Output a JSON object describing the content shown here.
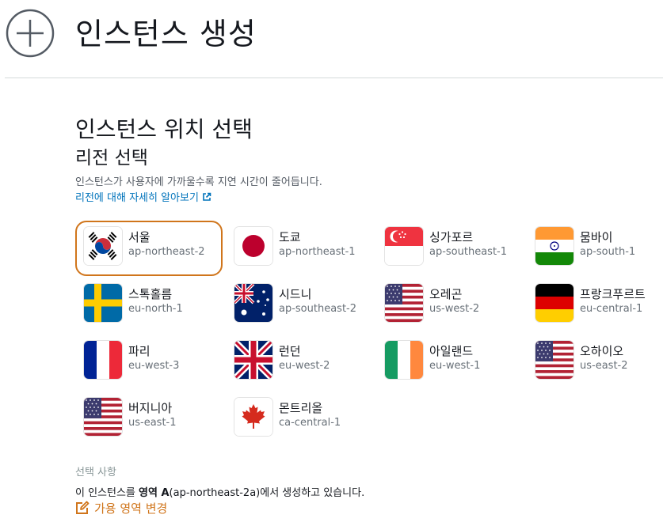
{
  "header": {
    "title": "인스턴스 생성",
    "icon": "plus-circle-icon"
  },
  "section": {
    "title": "인스턴스 위치 선택",
    "subtitle": "리전 선택",
    "description": "인스턴스가 사용자에 가까울수록 지연 시간이 줄어듭니다.",
    "learn_more": "리전에 대해 자세히 알아보기"
  },
  "regions": [
    {
      "name": "서울",
      "code": "ap-northeast-2",
      "flag": "korea-flag-icon",
      "selected": true
    },
    {
      "name": "도쿄",
      "code": "ap-northeast-1",
      "flag": "japan-flag-icon"
    },
    {
      "name": "싱가포르",
      "code": "ap-southeast-1",
      "flag": "singapore-flag-icon"
    },
    {
      "name": "뭄바이",
      "code": "ap-south-1",
      "flag": "india-flag-icon"
    },
    {
      "name": "스톡홀름",
      "code": "eu-north-1",
      "flag": "sweden-flag-icon"
    },
    {
      "name": "시드니",
      "code": "ap-southeast-2",
      "flag": "australia-flag-icon"
    },
    {
      "name": "오레곤",
      "code": "us-west-2",
      "flag": "usa-flag-icon"
    },
    {
      "name": "프랑크푸르트",
      "code": "eu-central-1",
      "flag": "germany-flag-icon"
    },
    {
      "name": "파리",
      "code": "eu-west-3",
      "flag": "france-flag-icon"
    },
    {
      "name": "런던",
      "code": "eu-west-2",
      "flag": "uk-flag-icon"
    },
    {
      "name": "아일랜드",
      "code": "eu-west-1",
      "flag": "ireland-flag-icon"
    },
    {
      "name": "오하이오",
      "code": "us-east-2",
      "flag": "usa-flag-icon"
    },
    {
      "name": "버지니아",
      "code": "us-east-1",
      "flag": "usa-flag-icon"
    },
    {
      "name": "몬트리올",
      "code": "ca-central-1",
      "flag": "canada-flag-icon"
    }
  ],
  "selection": {
    "label": "선택 사항",
    "text_prefix": "이 인스턴스를 ",
    "zone_bold": "영역 A",
    "text_suffix": "(ap-northeast-2a)에서 생성하고 있습니다.",
    "change_link": "가용 영역 변경"
  },
  "colors": {
    "accent": "#d0751b",
    "link": "#0073bb",
    "muted": "#687078"
  }
}
